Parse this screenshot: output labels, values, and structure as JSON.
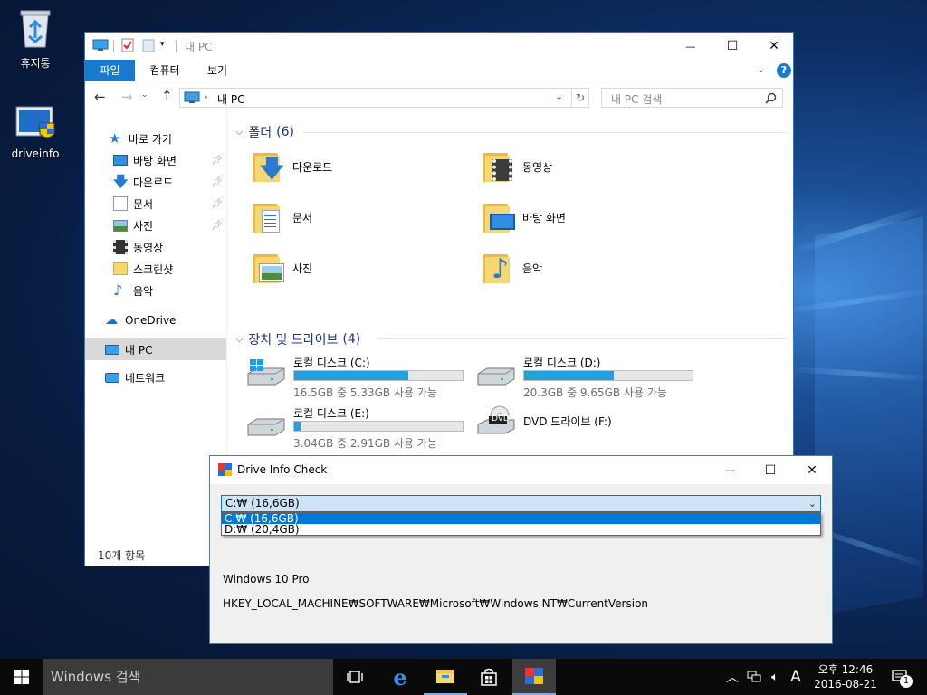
{
  "desktop": {
    "icons": [
      {
        "label": "휴지통",
        "icon": "recycle-bin-icon"
      },
      {
        "label": "driveinfo",
        "icon": "driveinfo-app-icon"
      }
    ]
  },
  "explorer": {
    "title": "내 PC",
    "window_buttons": {
      "minimize": "—",
      "maximize": "☐",
      "close": "✕"
    },
    "ribbon_tabs": [
      "파일",
      "컴퓨터",
      "보기"
    ],
    "ribbon_active_color": "#1979ca",
    "address": {
      "path": "내 PC",
      "separator": "›"
    },
    "search_placeholder": "내 PC 검색",
    "nav": {
      "quick_access": "바로 가기",
      "pinned": [
        "바탕 화면",
        "다운로드",
        "문서",
        "사진"
      ],
      "unpinned": [
        "동영상",
        "스크린샷",
        "음악"
      ],
      "onedrive": "OneDrive",
      "this_pc": "내 PC",
      "network": "네트워크"
    },
    "folders_header": "폴더",
    "folders_count": "(6)",
    "folders": [
      {
        "name": "다운로드",
        "icon": "download-folder-icon"
      },
      {
        "name": "동영상",
        "icon": "videos-folder-icon"
      },
      {
        "name": "문서",
        "icon": "documents-folder-icon"
      },
      {
        "name": "바탕 화면",
        "icon": "desktop-folder-icon"
      },
      {
        "name": "사진",
        "icon": "pictures-folder-icon"
      },
      {
        "name": "음악",
        "icon": "music-folder-icon"
      }
    ],
    "drives_header": "장치 및 드라이브",
    "drives_count": "(4)",
    "drives": [
      {
        "name": "로컬 디스크 (C:)",
        "free_text": "16.5GB 중 5.33GB 사용 가능",
        "used_fraction": 0.68,
        "icon": "windows-drive-icon"
      },
      {
        "name": "로컬 디스크 (D:)",
        "free_text": "20.3GB 중 9.65GB 사용 가능",
        "used_fraction": 0.53,
        "icon": "hard-drive-icon"
      },
      {
        "name": "로컬 디스크 (E:)",
        "free_text": "3.04GB 중 2.91GB 사용 가능",
        "used_fraction": 0.04,
        "icon": "hard-drive-icon"
      },
      {
        "name": "DVD 드라이브 (F:)",
        "icon": "dvd-drive-icon",
        "badge": "DVD"
      }
    ],
    "status": "10개 항목"
  },
  "dialog": {
    "title": "Drive Info Check",
    "combo_value": "C:₩ (16,6GB)",
    "options": [
      "C:₩ (16,6GB)",
      "D:₩ (20,4GB)"
    ],
    "os": "Windows 10 Pro",
    "registry": "HKEY_LOCAL_MACHINE₩SOFTWARE₩Microsoft₩Windows NT₩CurrentVersion"
  },
  "taskbar": {
    "search": "Windows 검색",
    "ime": "A",
    "time": "오후 12:46",
    "date": "2016-08-21",
    "notification_count": "1"
  }
}
